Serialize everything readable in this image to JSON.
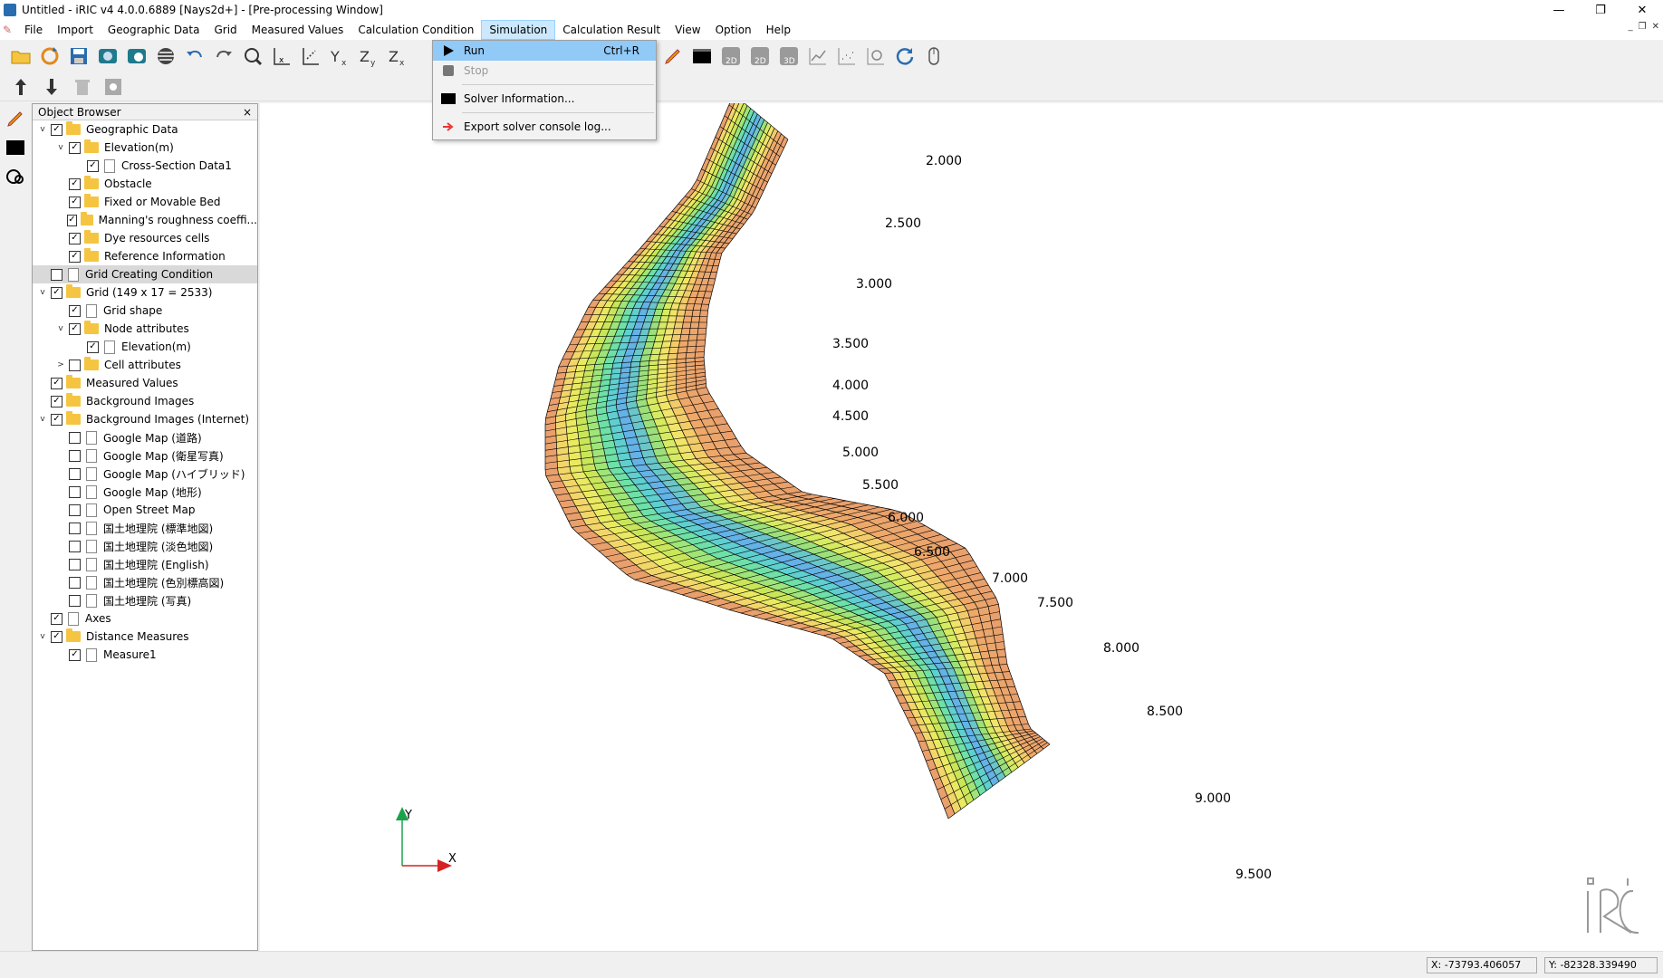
{
  "window": {
    "title": "Untitled - iRIC v4 4.0.0.6889 [Nays2d+] - [Pre-processing Window]",
    "controls": [
      "—",
      "❐",
      "✕"
    ]
  },
  "menu": {
    "items": [
      "File",
      "Import",
      "Geographic Data",
      "Grid",
      "Measured Values",
      "Calculation Condition",
      "Simulation",
      "Calculation Result",
      "View",
      "Option",
      "Help"
    ],
    "active": "Simulation"
  },
  "simulation_menu": {
    "run": {
      "label": "Run",
      "shortcut": "Ctrl+R"
    },
    "stop": {
      "label": "Stop"
    },
    "solver_info": {
      "label": "Solver Information..."
    },
    "export_log": {
      "label": "Export solver console log..."
    }
  },
  "toolbar": {
    "view_labels": [
      "2D",
      "2D",
      "3D"
    ]
  },
  "object_browser": {
    "title": "Object Browser",
    "close": "×",
    "items": [
      {
        "label": "Geographic Data",
        "expand": "v",
        "checked": true,
        "kind": "folder",
        "indent": 0
      },
      {
        "label": "Elevation(m)",
        "expand": "v",
        "checked": true,
        "kind": "folder",
        "indent": 1
      },
      {
        "label": "Cross-Section Data1",
        "expand": "",
        "checked": true,
        "kind": "doc",
        "indent": 2
      },
      {
        "label": "Obstacle",
        "expand": "",
        "checked": true,
        "kind": "folder",
        "indent": 1
      },
      {
        "label": "Fixed or Movable Bed",
        "expand": "",
        "checked": true,
        "kind": "folder",
        "indent": 1
      },
      {
        "label": "Manning's roughness coeffi...",
        "expand": "",
        "checked": true,
        "kind": "folder",
        "indent": 1
      },
      {
        "label": "Dye resources cells",
        "expand": "",
        "checked": true,
        "kind": "folder",
        "indent": 1
      },
      {
        "label": "Reference Information",
        "expand": "",
        "checked": true,
        "kind": "folder",
        "indent": 1
      },
      {
        "label": "Grid Creating Condition",
        "expand": "",
        "checked": false,
        "kind": "doc",
        "indent": 0,
        "selected": true
      },
      {
        "label": "Grid (149 x 17 = 2533)",
        "expand": "v",
        "checked": true,
        "kind": "folder",
        "indent": 0
      },
      {
        "label": "Grid shape",
        "expand": "",
        "checked": true,
        "kind": "doc",
        "indent": 1
      },
      {
        "label": "Node attributes",
        "expand": "v",
        "checked": true,
        "kind": "folder",
        "indent": 1
      },
      {
        "label": "Elevation(m)",
        "expand": "",
        "checked": true,
        "kind": "doc",
        "indent": 2
      },
      {
        "label": "Cell attributes",
        "expand": ">",
        "checked": false,
        "kind": "folder",
        "indent": 1
      },
      {
        "label": "Measured Values",
        "expand": "",
        "checked": true,
        "kind": "folder",
        "indent": 0
      },
      {
        "label": "Background Images",
        "expand": "",
        "checked": true,
        "kind": "folder",
        "indent": 0
      },
      {
        "label": "Background Images (Internet)",
        "expand": "v",
        "checked": true,
        "kind": "folder",
        "indent": 0
      },
      {
        "label": "Google Map (道路)",
        "expand": "",
        "checked": false,
        "kind": "doc",
        "indent": 1
      },
      {
        "label": "Google Map (衛星写真)",
        "expand": "",
        "checked": false,
        "kind": "doc",
        "indent": 1
      },
      {
        "label": "Google Map (ハイブリッド)",
        "expand": "",
        "checked": false,
        "kind": "doc",
        "indent": 1
      },
      {
        "label": "Google Map (地形)",
        "expand": "",
        "checked": false,
        "kind": "doc",
        "indent": 1
      },
      {
        "label": "Open Street Map",
        "expand": "",
        "checked": false,
        "kind": "doc",
        "indent": 1
      },
      {
        "label": "国土地理院 (標準地図)",
        "expand": "",
        "checked": false,
        "kind": "doc",
        "indent": 1
      },
      {
        "label": "国土地理院 (淡色地図)",
        "expand": "",
        "checked": false,
        "kind": "doc",
        "indent": 1
      },
      {
        "label": "国土地理院 (English)",
        "expand": "",
        "checked": false,
        "kind": "doc",
        "indent": 1
      },
      {
        "label": "国土地理院 (色別標高図)",
        "expand": "",
        "checked": false,
        "kind": "doc",
        "indent": 1
      },
      {
        "label": "国土地理院 (写真)",
        "expand": "",
        "checked": false,
        "kind": "doc",
        "indent": 1
      },
      {
        "label": "Axes",
        "expand": "",
        "checked": true,
        "kind": "doc",
        "indent": 0
      },
      {
        "label": "Distance Measures",
        "expand": "v",
        "checked": true,
        "kind": "folder",
        "indent": 0
      },
      {
        "label": "Measure1",
        "expand": "",
        "checked": true,
        "kind": "doc",
        "indent": 1
      }
    ]
  },
  "canvas": {
    "cross_section_labels": [
      "2.000",
      "2.500",
      "3.000",
      "3.500",
      "4.000",
      "4.500",
      "5.000",
      "5.500",
      "6.000",
      "6.500",
      "7.000",
      "7.500",
      "8.000",
      "8.500",
      "9.000",
      "9.500"
    ],
    "axis_x": "X",
    "axis_y": "Y"
  },
  "status": {
    "x": "X: -73793.406057",
    "y": "Y: -82328.339490"
  }
}
